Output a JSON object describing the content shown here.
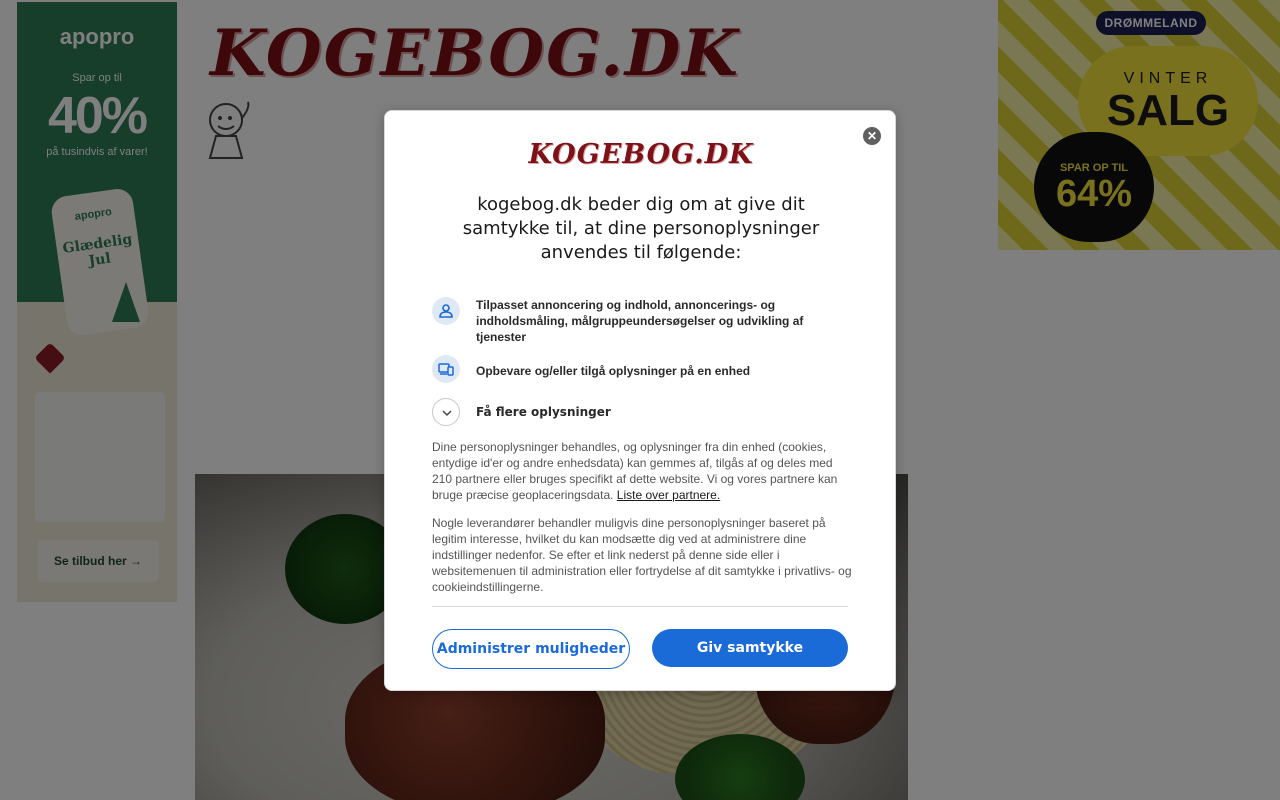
{
  "site": {
    "logo": "KOGEBOG.DK"
  },
  "ads": {
    "left": {
      "brand": "apopro",
      "headline_small": "Spar op til",
      "headline_big": "40%",
      "headline_sub": "på tusindvis af varer!",
      "tag_brand": "apopro",
      "tag_greeting": "Glædelig Jul",
      "cta": "Se tilbud her →"
    },
    "right": {
      "brand": "DRØMMELAND",
      "line1": "VINTER",
      "line2": "SALG",
      "badge_small": "SPAR OP TIL",
      "badge_big": "64%"
    }
  },
  "consent": {
    "logo": "KOGEBOG.DK",
    "close_icon": "close-icon",
    "title": "kogebog.dk beder dig om at give dit samtykke til, at dine personoplysninger anvendes til følgende:",
    "purposes": [
      {
        "icon": "person-icon",
        "label": "Tilpasset annoncering og indhold, annoncerings- og indholdsmåling, målgruppeundersøgelser og udvikling af tjenester"
      },
      {
        "icon": "devices-icon",
        "label": "Opbevare og/eller tilgå oplysninger på en enhed"
      }
    ],
    "more_info": "Få flere oplysninger",
    "paragraph1": "Dine personoplysninger behandles, og oplysninger fra din enhed (cookies, entydige id'er og andre enhedsdata) kan gemmes af, tilgås af og deles med 210 partnere eller bruges specifikt af dette website. Vi og vores partnere kan bruge præcise geoplaceringsdata.",
    "partners_link": "Liste over partnere.",
    "paragraph2": "Nogle leverandører behandler muligvis dine personoplysninger baseret på legitim interesse, hvilket du kan modsætte dig ved at administrere dine indstillinger nedenfor. Se efter et link nederst på denne side eller i websitemenuen til administration eller fortrydelse af dit samtykke i privatlivs- og cookieindstillingerne.",
    "manage_button": "Administrer muligheder",
    "consent_button": "Giv samtykke",
    "accent_color": "#1a6ad8"
  }
}
